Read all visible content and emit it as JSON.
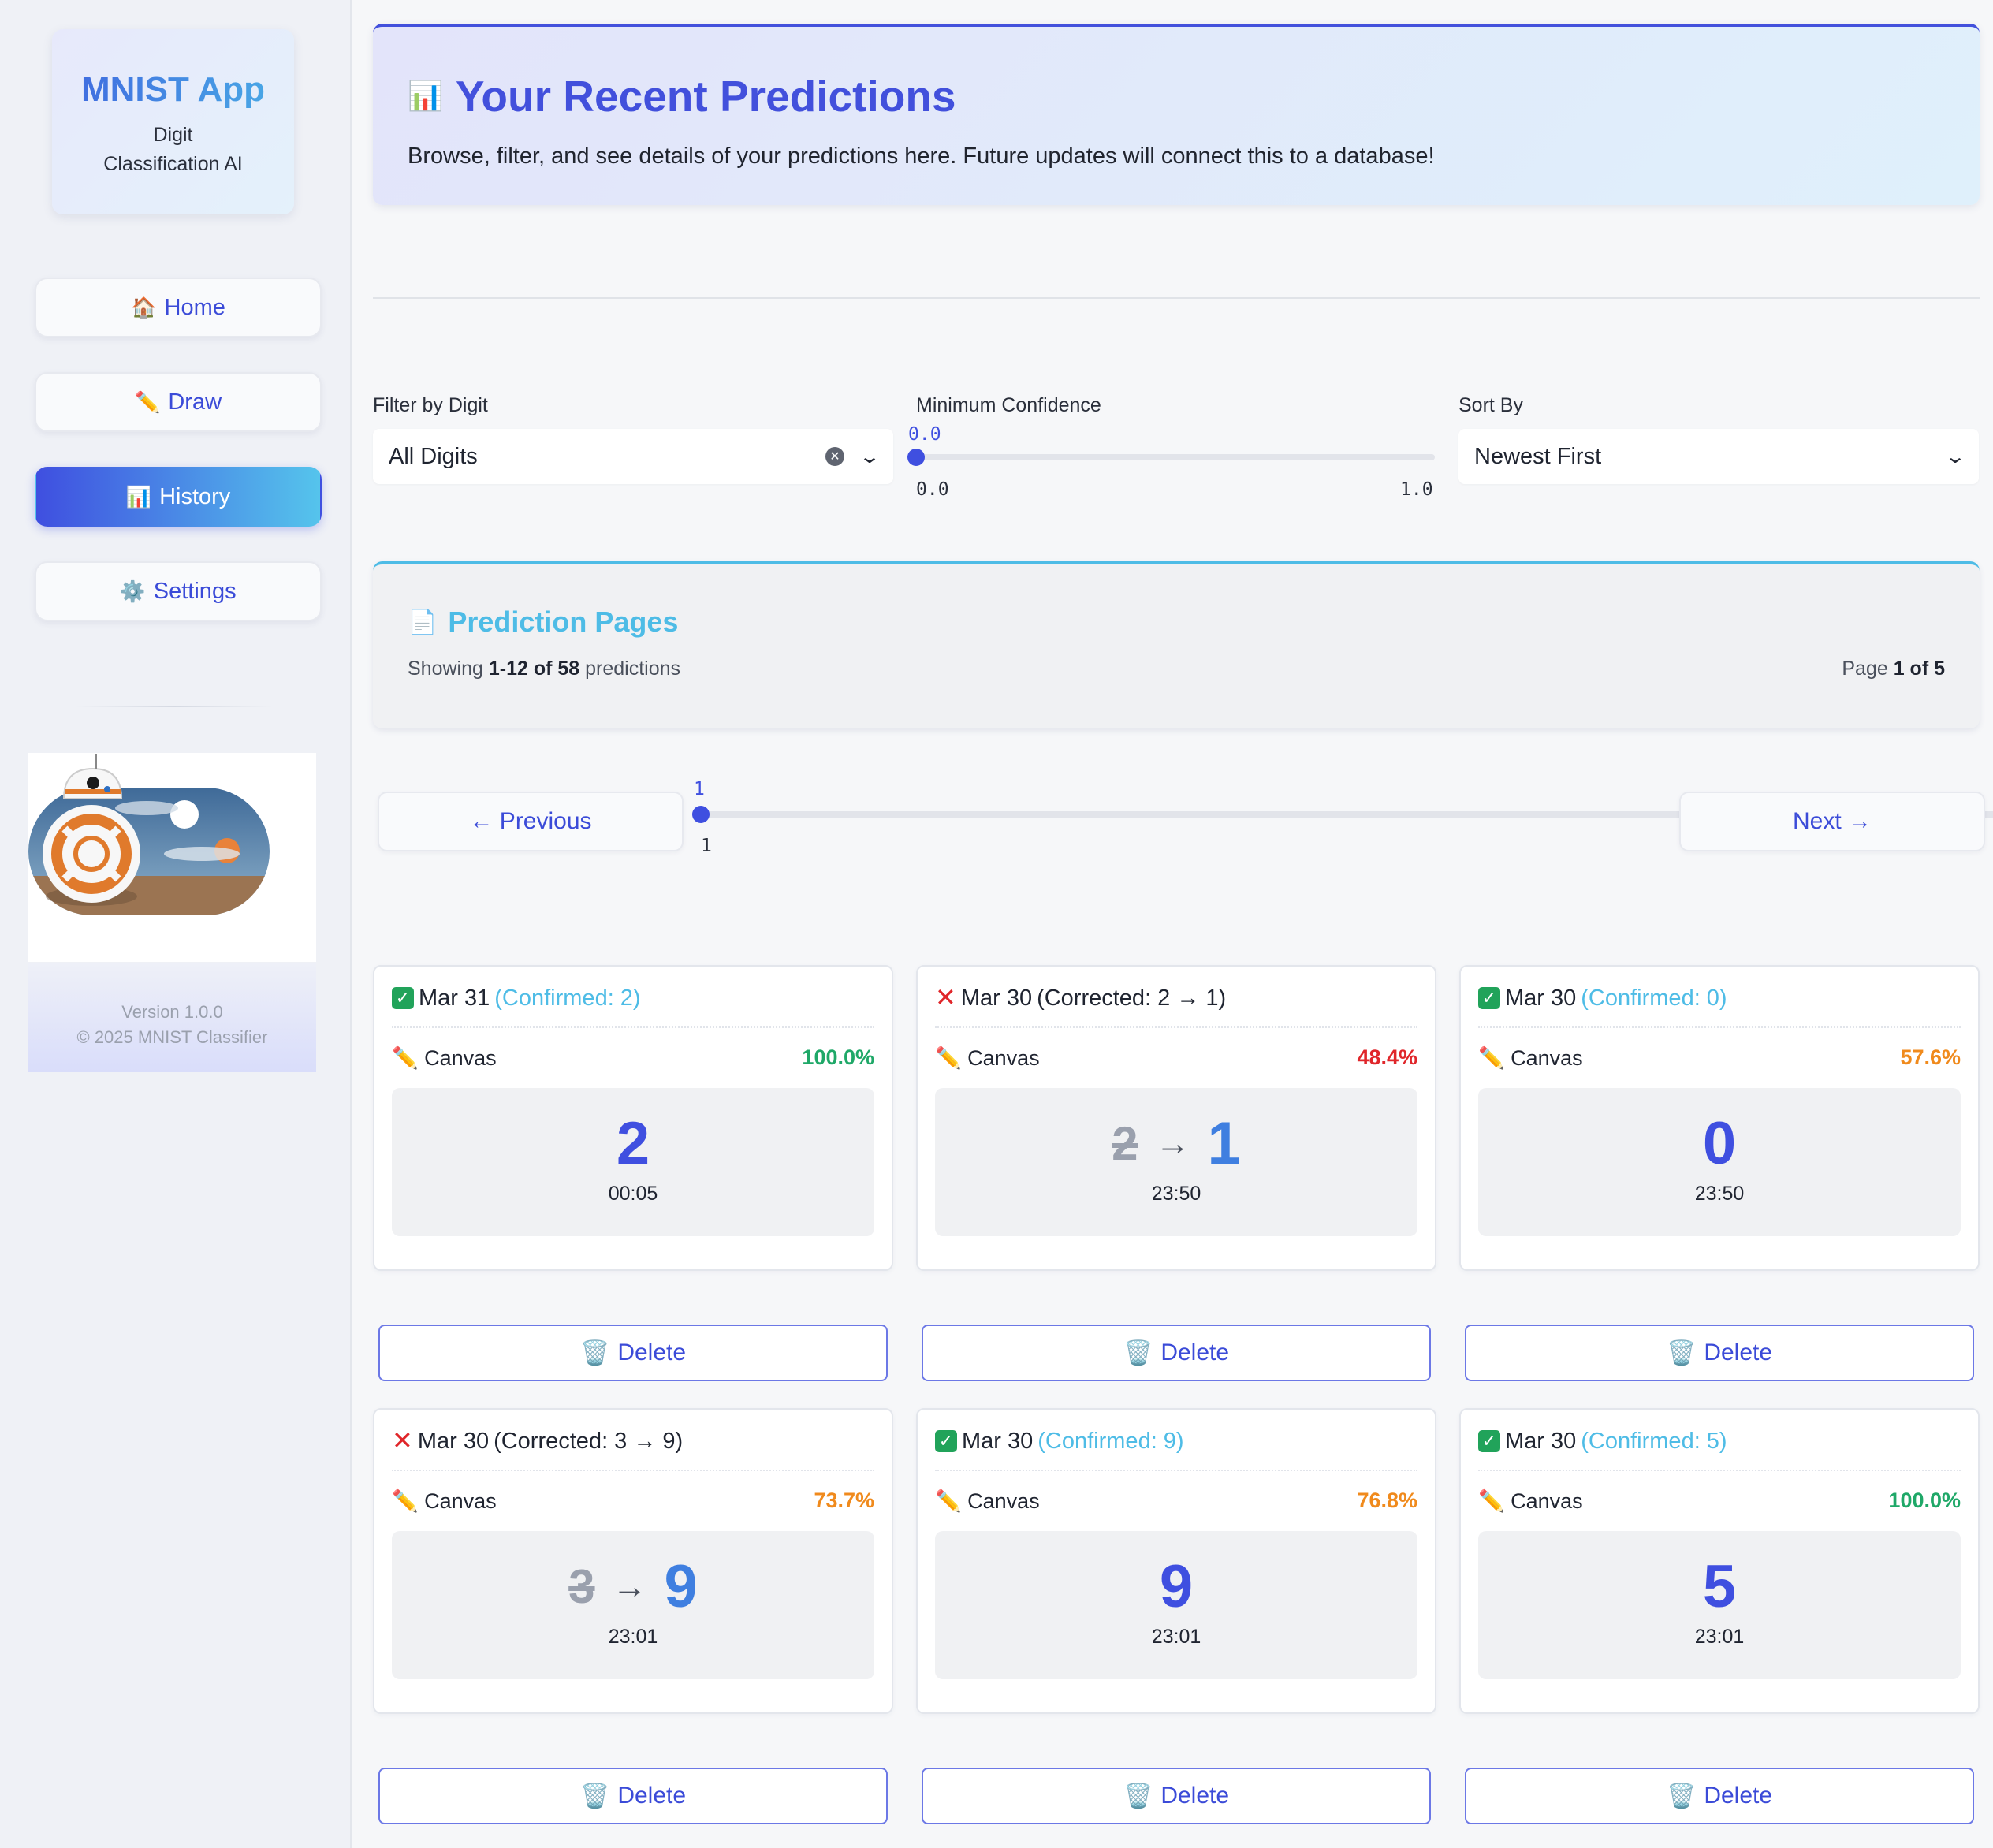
{
  "sidebar": {
    "brand_title": "MNIST App",
    "brand_subtitle_1": "Digit",
    "brand_subtitle_2": "Classification AI",
    "nav": [
      {
        "icon": "🏠",
        "label": "Home"
      },
      {
        "icon": "✏️",
        "label": "Draw"
      },
      {
        "icon": "📊",
        "label": "History"
      },
      {
        "icon": "⚙️",
        "label": "Settings"
      }
    ],
    "version": "Version 1.0.0",
    "copyright": "© 2025 MNIST Classifier"
  },
  "header": {
    "icon": "📊",
    "title": "Your Recent Predictions",
    "description": "Browse, filter, and see details of your predictions here. Future updates will connect this to a database!"
  },
  "filters": {
    "digit_label": "Filter by Digit",
    "digit_value": "All Digits",
    "confidence_label": "Minimum Confidence",
    "confidence_value": "0.0",
    "confidence_min": "0.0",
    "confidence_max": "1.0",
    "sort_label": "Sort By",
    "sort_value": "Newest First"
  },
  "pages": {
    "icon": "📄",
    "title": "Prediction Pages",
    "showing_prefix": "Showing ",
    "showing_range": "1-12 of 58",
    "showing_suffix": " predictions",
    "page_prefix": "Page ",
    "page_value": "1 of 5",
    "prev_label": "← Previous",
    "next_label": "Next →",
    "slider_value": "1",
    "slider_min": "1",
    "slider_max": "5"
  },
  "predictions": [
    {
      "status": "ok",
      "date": "Mar 31",
      "tag": "(Confirmed: 2)",
      "source": "✏️ Canvas",
      "confidence": "100.0%",
      "conf_color": "#1fa868",
      "digit": "2",
      "time": "00:05"
    },
    {
      "status": "x",
      "date": "Mar 30",
      "tag": "(Corrected: 2 → 1)",
      "source": "✏️ Canvas",
      "confidence": "48.4%",
      "conf_color": "#e0262a",
      "old": "2",
      "arrow": "→",
      "new": "1",
      "time": "23:50"
    },
    {
      "status": "ok",
      "date": "Mar 30",
      "tag": "(Confirmed: 0)",
      "source": "✏️ Canvas",
      "confidence": "57.6%",
      "conf_color": "#f08a1c",
      "digit": "0",
      "time": "23:50"
    },
    {
      "status": "x",
      "date": "Mar 30",
      "tag": "(Corrected: 3 → 9)",
      "source": "✏️ Canvas",
      "confidence": "73.7%",
      "conf_color": "#f08a1c",
      "old": "3",
      "arrow": "→",
      "new": "9",
      "time": "23:01"
    },
    {
      "status": "ok",
      "date": "Mar 30",
      "tag": "(Confirmed: 9)",
      "source": "✏️ Canvas",
      "confidence": "76.8%",
      "conf_color": "#f08a1c",
      "digit": "9",
      "time": "23:01"
    },
    {
      "status": "ok",
      "date": "Mar 30",
      "tag": "(Confirmed: 5)",
      "source": "✏️ Canvas",
      "confidence": "100.0%",
      "conf_color": "#1fa868",
      "digit": "5",
      "time": "23:01"
    }
  ],
  "delete_label": "Delete",
  "delete_icon": "🗑️"
}
